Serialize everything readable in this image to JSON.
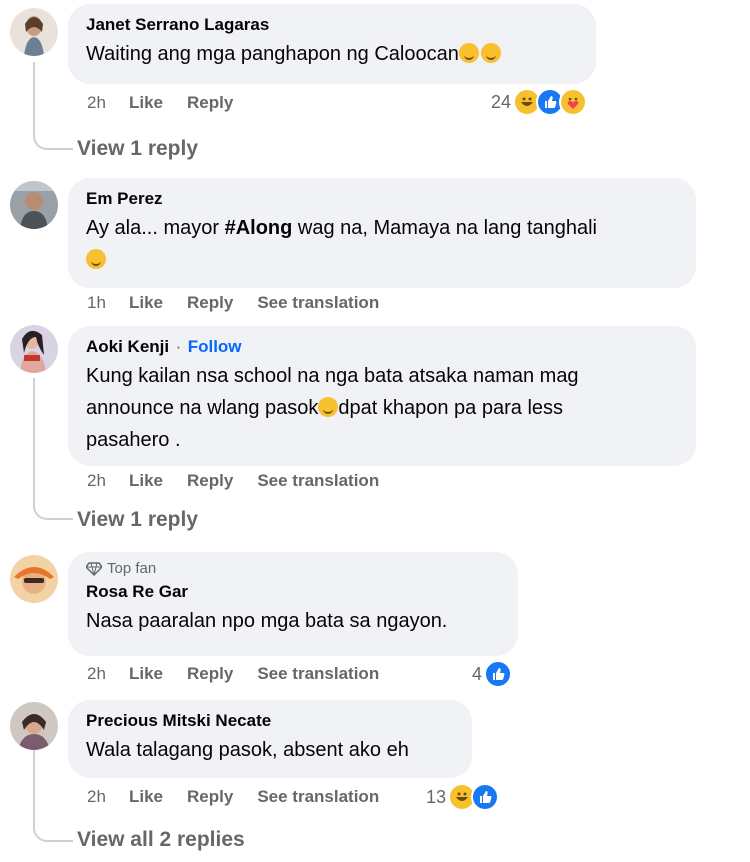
{
  "comments": [
    {
      "author": "Janet Serrano Lagaras",
      "text": "Waiting ang mga panghapon ng Caloocan",
      "time": "2h",
      "like": "Like",
      "reply": "Reply",
      "reactions_count": "24",
      "reaction_icons": [
        "haha-icon",
        "like-icon",
        "care-icon"
      ],
      "view_replies": "View 1 reply"
    },
    {
      "author": "Em Perez",
      "text_before": "Ay ala... mayor ",
      "hashtag": "#Along",
      "text_after": " wag na, Mamaya na lang tanghali",
      "time": "1h",
      "like": "Like",
      "reply": "Reply",
      "translate": "See translation"
    },
    {
      "author": "Aoki Kenji",
      "follow": "Follow",
      "separator": "·",
      "text_line1": "Kung kailan nsa school na nga bata atsaka naman mag",
      "text_line2a": "announce na wlang pasok",
      "text_line2b": "dpat khapon pa para less",
      "text_line3": "pasahero .",
      "time": "2h",
      "like": "Like",
      "reply": "Reply",
      "translate": "See translation",
      "view_replies": "View 1 reply"
    },
    {
      "badge": "Top fan",
      "author": "Rosa Re Gar",
      "text": "Nasa paaralan npo mga bata sa ngayon.",
      "time": "2h",
      "like": "Like",
      "reply": "Reply",
      "translate": "See translation",
      "reactions_count": "4",
      "reaction_icons": [
        "like-icon"
      ]
    },
    {
      "author": "Precious Mitski Necate",
      "text": "Wala talagang pasok, absent ako eh",
      "time": "2h",
      "like": "Like",
      "reply": "Reply",
      "translate": "See translation",
      "reactions_count": "13",
      "reaction_icons": [
        "haha-icon",
        "like-icon"
      ],
      "view_replies": "View all 2 replies"
    }
  ],
  "colors": {
    "bubble": "#f0f2f5",
    "muted": "#65676b",
    "link": "#0866ff",
    "like": "#1877f2",
    "haha": "#f7c02f"
  }
}
